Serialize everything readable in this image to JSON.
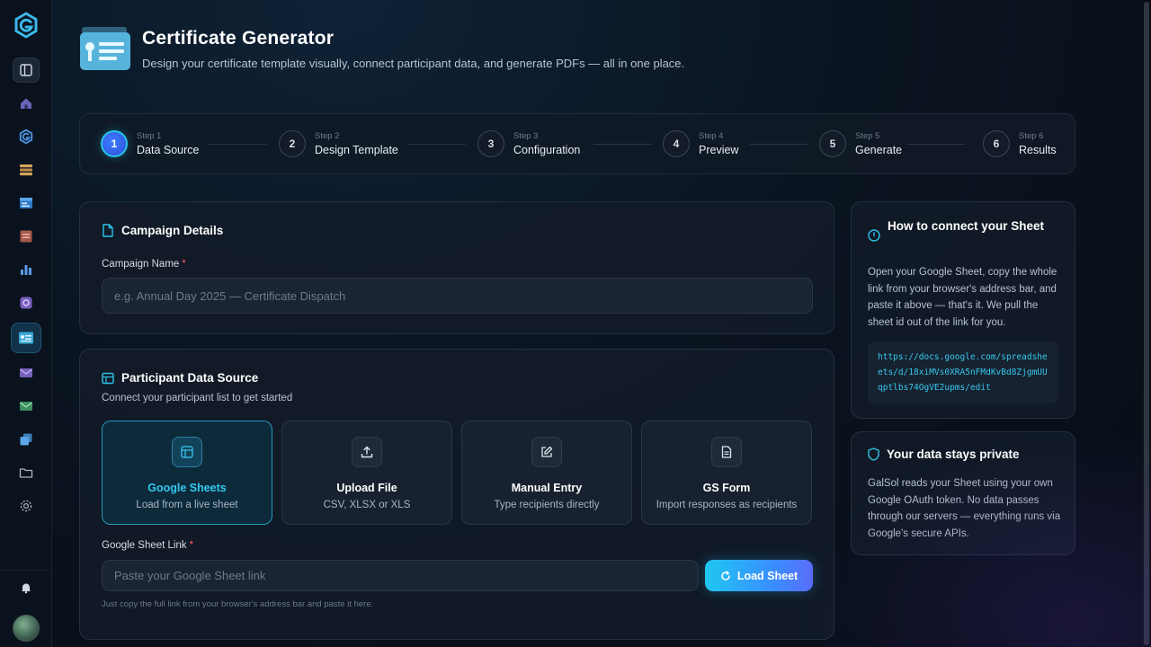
{
  "header": {
    "title": "Certificate Generator",
    "subtitle": "Design your certificate template visually, connect participant data, and generate PDFs — all in one place."
  },
  "stepper": {
    "steps": [
      {
        "small": "Step 1",
        "label": "Data Source",
        "num": "1",
        "active": true
      },
      {
        "small": "Step 2",
        "label": "Design Template",
        "num": "2",
        "active": false
      },
      {
        "small": "Step 3",
        "label": "Configuration",
        "num": "3",
        "active": false
      },
      {
        "small": "Step 4",
        "label": "Preview",
        "num": "4",
        "active": false
      },
      {
        "small": "Step 5",
        "label": "Generate",
        "num": "5",
        "active": false
      },
      {
        "small": "Step 6",
        "label": "Results",
        "num": "6",
        "active": false
      }
    ]
  },
  "campaign": {
    "title": "Campaign Details",
    "name_label": "Campaign Name",
    "required": "*",
    "name_placeholder": "e.g. Annual Day 2025 — Certificate Dispatch",
    "name_value": ""
  },
  "participant": {
    "title": "Participant Data Source",
    "subtitle": "Connect your participant list to get started",
    "sources": [
      {
        "title": "Google Sheets",
        "sub": "Load from a live sheet",
        "icon": "sheet-icon",
        "active": true
      },
      {
        "title": "Upload File",
        "sub": "CSV, XLSX or XLS",
        "icon": "upload-icon",
        "active": false
      },
      {
        "title": "Manual Entry",
        "sub": "Type recipients directly",
        "icon": "edit-icon",
        "active": false
      },
      {
        "title": "GS Form",
        "sub": "Import responses as recipients",
        "icon": "document-icon",
        "active": false
      }
    ],
    "link_label": "Google Sheet Link",
    "required": "*",
    "link_placeholder": "Paste your Google Sheet link",
    "link_value": "",
    "load_button": "Load Sheet",
    "hint": "Just copy the full link from your browser's address bar and paste it here."
  },
  "howto": {
    "title": "How to connect your Sheet",
    "text": "Open your Google Sheet, copy the whole link from your browser's address bar, and paste it above — that's it. We pull the sheet id out of the link for you.",
    "example_url": "https://docs.google.com/spreadsheets/d/18xiMVs0XRA5nFMdKvBd8ZjgmUUqptlbs74OgVE2upms/edit"
  },
  "privacy": {
    "title": "Your data stays private",
    "text": "GalSol reads your Sheet using your own Google OAuth token. No data passes through our servers — everything runs via Google's secure APIs."
  },
  "sidebar": {
    "items": [
      "sidebar-toggle-icon",
      "home-icon",
      "logo-icon",
      "layers-icon",
      "browser-icon",
      "id-card-icon",
      "bar-chart-icon",
      "camera-icon",
      "certificate-icon",
      "mail-icon",
      "inbox-icon",
      "stack-icon",
      "folder-icon",
      "gear-icon"
    ],
    "active_index": 8
  },
  "colors": {
    "accent": "#27c3e6",
    "primary_gradient_end": "#5a6cf8",
    "required": "#ff5a66"
  }
}
